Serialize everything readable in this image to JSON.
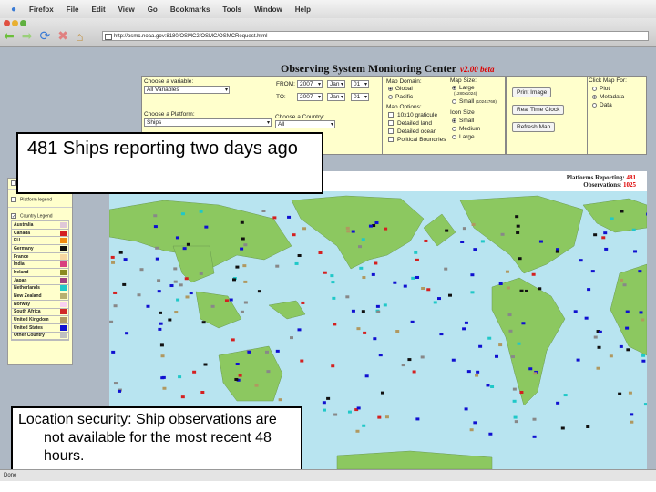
{
  "browser": {
    "menu": [
      "Firefox",
      "File",
      "Edit",
      "View",
      "Go",
      "Bookmarks",
      "Tools",
      "Window",
      "Help"
    ],
    "url": "http://osmc.noaa.gov:8180/OSMC2/OSMC/OSMCRequest.html",
    "status": "Done"
  },
  "page": {
    "title": "Observing System Monitoring Center",
    "version": "v2.00 beta"
  },
  "form": {
    "variable_label": "Choose a variable:",
    "variable_value": "All Variables",
    "from_label": "FROM:",
    "to_label": "TO:",
    "from": {
      "year": "2007",
      "month": "Jan",
      "day": "01"
    },
    "to": {
      "year": "2007",
      "month": "Jan",
      "day": "01"
    },
    "platform_label": "Choose a Platform:",
    "platform_value": "Ships",
    "country_label": "Choose a Country:",
    "country_value": "All",
    "domain_label": "Map Domain:",
    "domain_options": [
      "Global",
      "Pacific"
    ],
    "size_label": "Map Size:",
    "size_large": "Large",
    "size_large_dim": "(1280x1024)",
    "size_small": "Small",
    "size_small_dim": "(1024x768)",
    "options_label": "Map Options:",
    "options": [
      "10x10 graticule",
      "Detailed land",
      "Detailed ocean",
      "Political Boundries"
    ],
    "icon_label": "Icon Size",
    "icon_options": [
      "Small",
      "Medium",
      "Large"
    ],
    "print": "Print Image",
    "clock": "Real Time Clock",
    "refresh": "Refresh Map",
    "click_label": "Click Map For:",
    "click_options": [
      "Plot",
      "Metadata",
      "Data"
    ]
  },
  "legend": {
    "platform": "Platform legend",
    "country": "Country Legend",
    "countries": [
      {
        "name": "Australia",
        "color": "#e0c8d8"
      },
      {
        "name": "Canada",
        "color": "#d42020"
      },
      {
        "name": "EU",
        "color": "#f08a10"
      },
      {
        "name": "Germany",
        "color": "#111111"
      },
      {
        "name": "France",
        "color": "#f8d8a0"
      },
      {
        "name": "India",
        "color": "#d84080"
      },
      {
        "name": "Ireland",
        "color": "#8a8a20"
      },
      {
        "name": "Japan",
        "color": "#a04080"
      },
      {
        "name": "Netherlands",
        "color": "#20c8c8"
      },
      {
        "name": "New Zealand",
        "color": "#b8b070"
      },
      {
        "name": "Norway",
        "color": "#f8d0f0"
      },
      {
        "name": "South Africa",
        "color": "#d02828"
      },
      {
        "name": "United Kingdom",
        "color": "#b09860"
      },
      {
        "name": "United States",
        "color": "#1010d0"
      },
      {
        "name": "Other Country",
        "color": "#c0c0c0"
      }
    ]
  },
  "map": {
    "platforms_label": "Platforms Reporting:",
    "platforms": "481",
    "obs_label": "Observations:",
    "obs": "1025",
    "ocean": "#b8e4f0",
    "land": "#8cc860"
  },
  "overlays": {
    "top": "481 Ships reporting two days ago",
    "bottom": "Location security:  Ship observations are not available for the most recent 48 hours."
  }
}
